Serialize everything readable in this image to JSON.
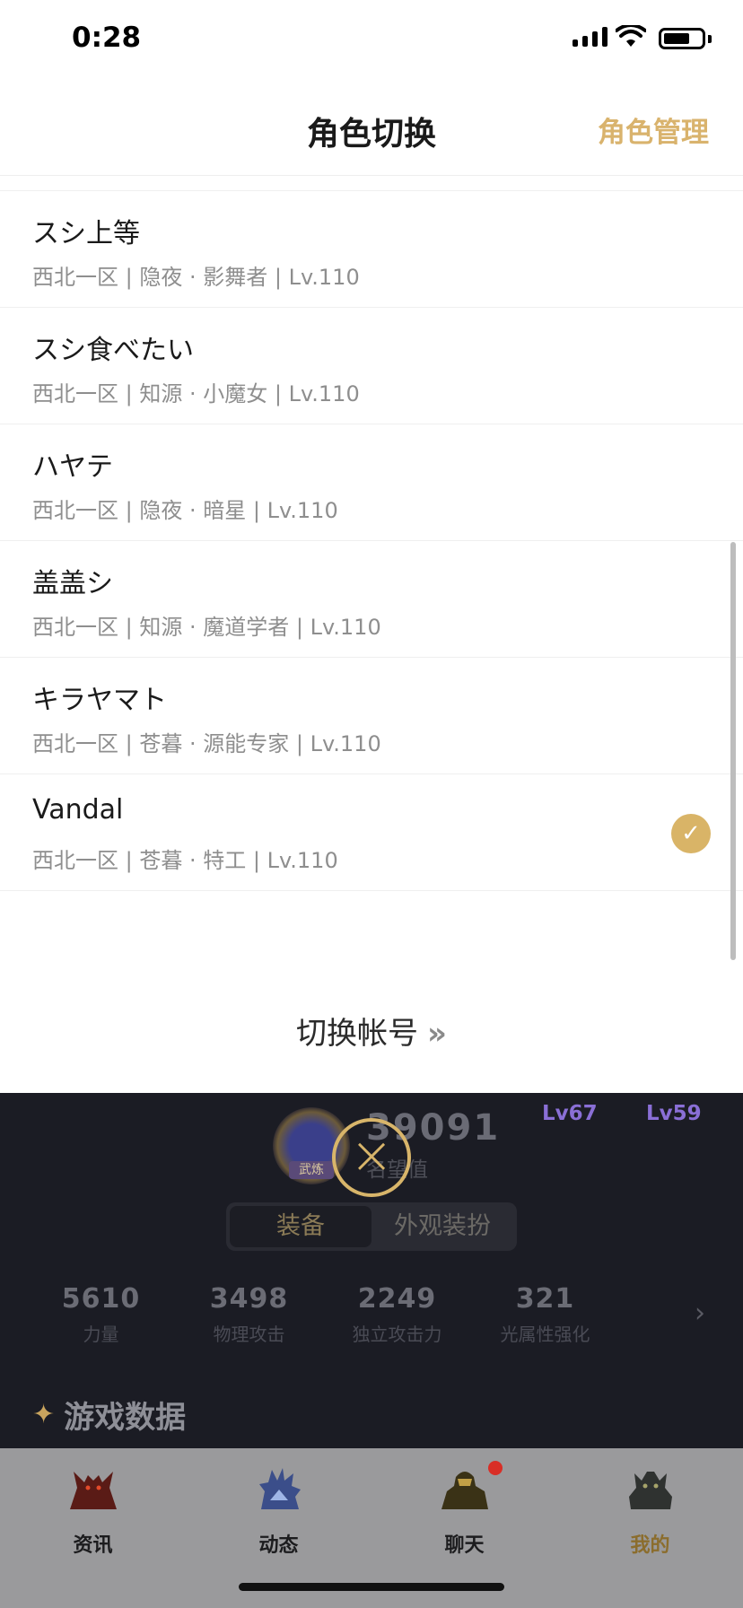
{
  "status_bar": {
    "time": "0:28"
  },
  "nav": {
    "title": "角色切换",
    "action": "角色管理"
  },
  "characters": [
    {
      "name": "スシ上等",
      "info": "西北一区 | 隐夜 · 影舞者 | Lv.110",
      "selected": false
    },
    {
      "name": "スシ食べたい",
      "info": "西北一区 | 知源 · 小魔女 | Lv.110",
      "selected": false
    },
    {
      "name": "ハヤテ",
      "info": "西北一区 | 隐夜 · 暗星 | Lv.110",
      "selected": false
    },
    {
      "name": "盖盖シ",
      "info": "西北一区 | 知源 · 魔道学者 | Lv.110",
      "selected": false
    },
    {
      "name": "キラヤマト",
      "info": "西北一区 | 苍暮 · 源能专家 | Lv.110",
      "selected": false
    },
    {
      "name": "Vandal",
      "info": "西北一区 | 苍暮 · 特工 | Lv.110",
      "selected": true
    }
  ],
  "switch_account": {
    "label": "切换帐号",
    "chevron": "»"
  },
  "background": {
    "levels": [
      "Lv67",
      "Lv59"
    ],
    "badge_label": "武炼",
    "close_icon": "×",
    "reputation": {
      "value": "39091",
      "label": "名望值"
    },
    "tabs": [
      {
        "label": "装备",
        "active": true
      },
      {
        "label": "外观装扮",
        "active": false
      }
    ],
    "stats": [
      {
        "value": "5610",
        "label": "力量"
      },
      {
        "value": "3498",
        "label": "物理攻击"
      },
      {
        "value": "2249",
        "label": "独立攻击力"
      },
      {
        "value": "321",
        "label": "光属性强化"
      }
    ],
    "stats_arrow": "›",
    "section": {
      "icon": "✦",
      "title": "游戏数据"
    }
  },
  "tabbar": [
    {
      "label": "资讯",
      "active": false,
      "badge": false,
      "icon": "demon-icon"
    },
    {
      "label": "动态",
      "active": false,
      "badge": false,
      "icon": "ice-creature-icon"
    },
    {
      "label": "聊天",
      "active": false,
      "badge": true,
      "icon": "warrior-icon"
    },
    {
      "label": "我的",
      "active": true,
      "badge": false,
      "icon": "beast-icon"
    }
  ],
  "colors": {
    "accent": "#d9b36d",
    "check": "#d9b467",
    "badge_red": "#d92e26",
    "backdrop": "#1b1c24"
  }
}
